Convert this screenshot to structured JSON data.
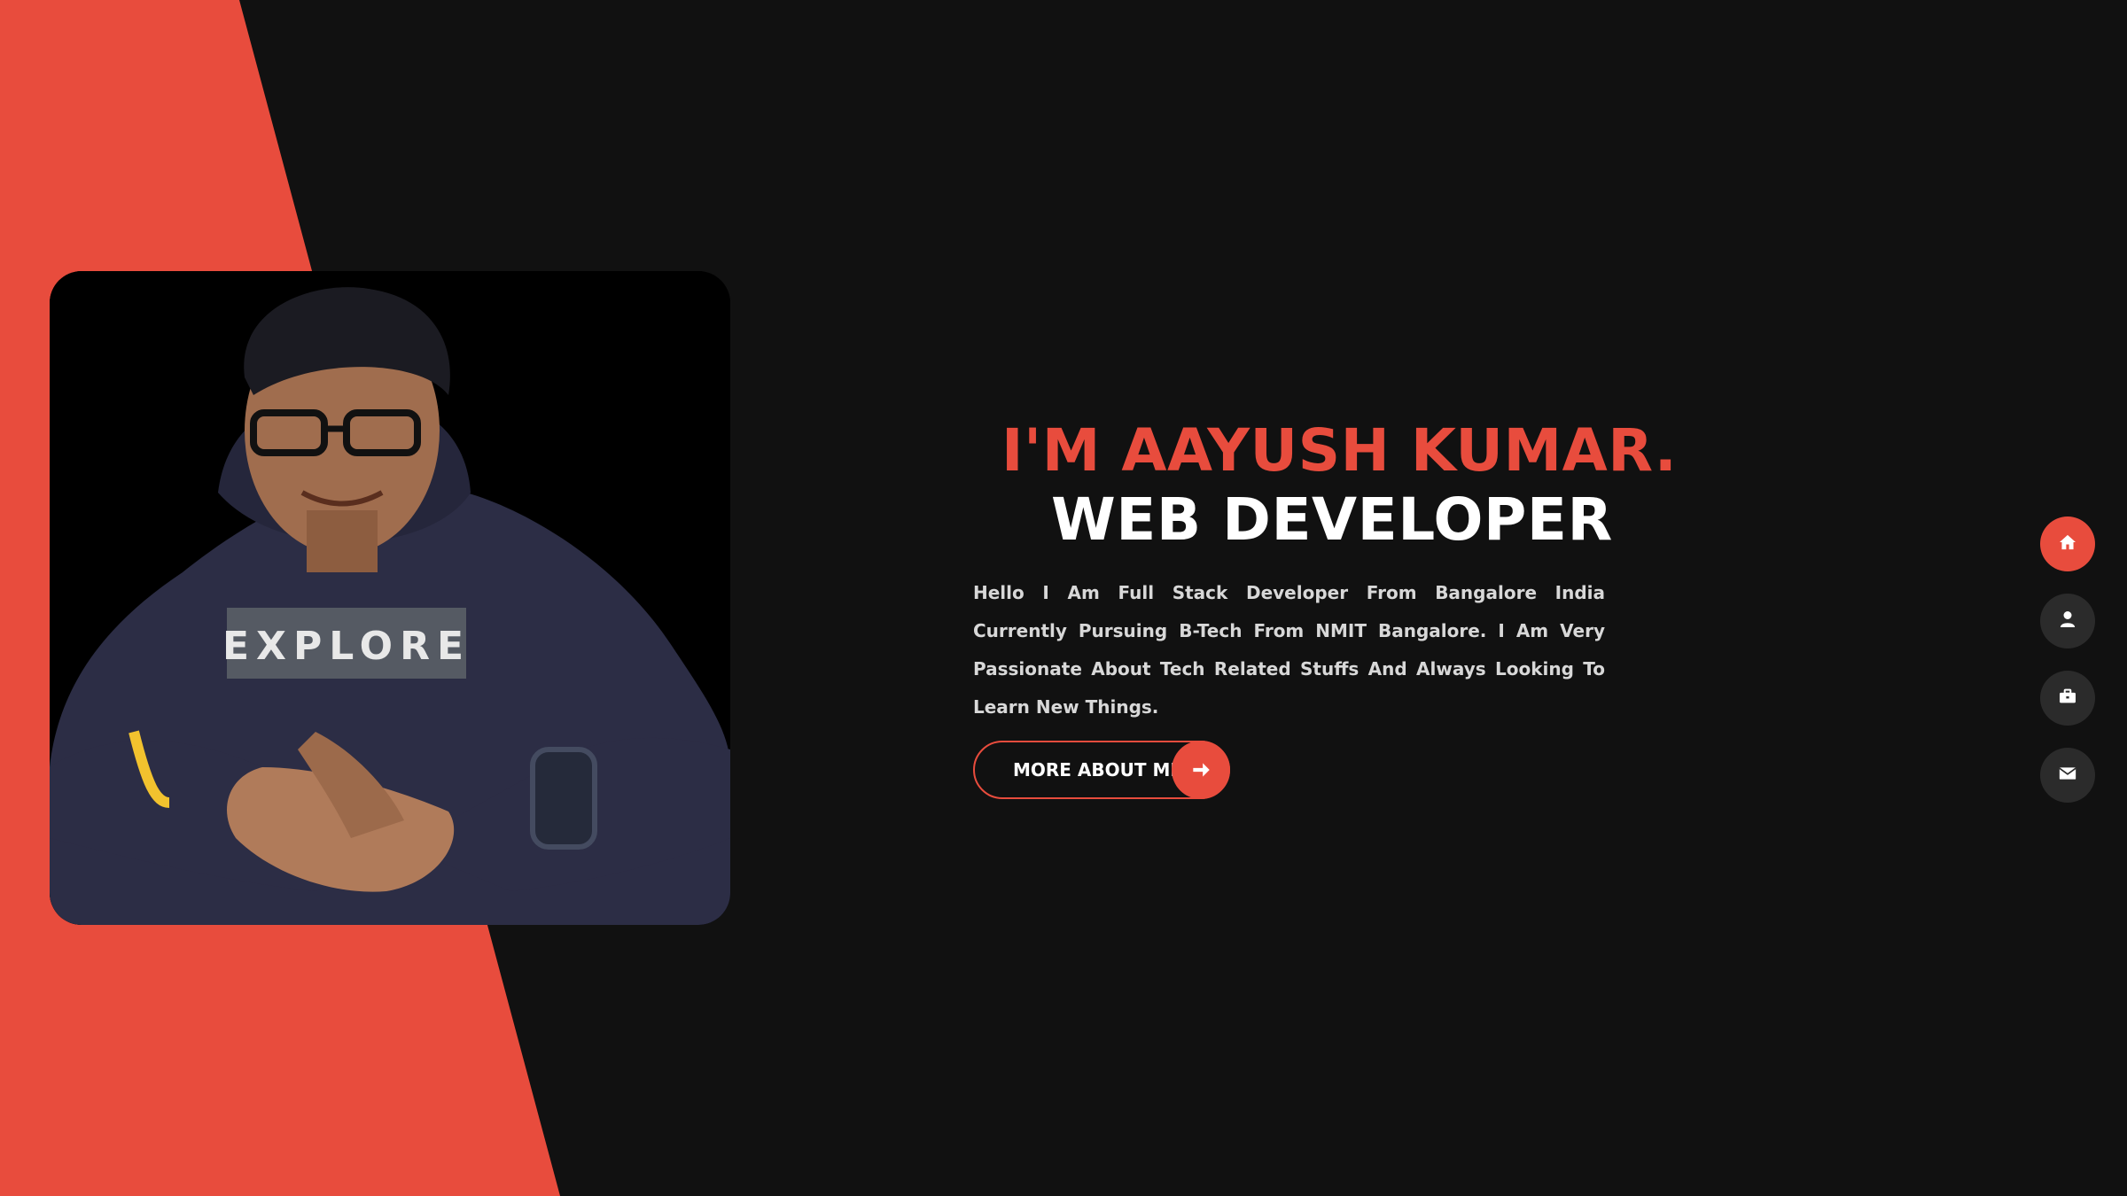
{
  "hero": {
    "name": "I'M AAYUSH KUMAR.",
    "role": "WEB DEVELOPER",
    "description": "Hello I Am Full Stack Developer From Bangalore India Currently Pursuing B-Tech From NMIT Bangalore. I Am Very Passionate About Tech Related Stuffs And Always Looking To Learn New Things.",
    "cta_label": "MORE ABOUT ME",
    "cta_icon": "arrow-right-icon",
    "photo_shirt_text": "EXPLORE"
  },
  "side_nav": {
    "items": [
      {
        "icon": "home-icon",
        "active": true
      },
      {
        "icon": "user-icon",
        "active": false
      },
      {
        "icon": "briefcase-icon",
        "active": false
      },
      {
        "icon": "envelope-icon",
        "active": false
      }
    ]
  },
  "colors": {
    "accent": "#e84c3d",
    "background": "#111111",
    "nav_inactive": "#2b2b2b"
  }
}
